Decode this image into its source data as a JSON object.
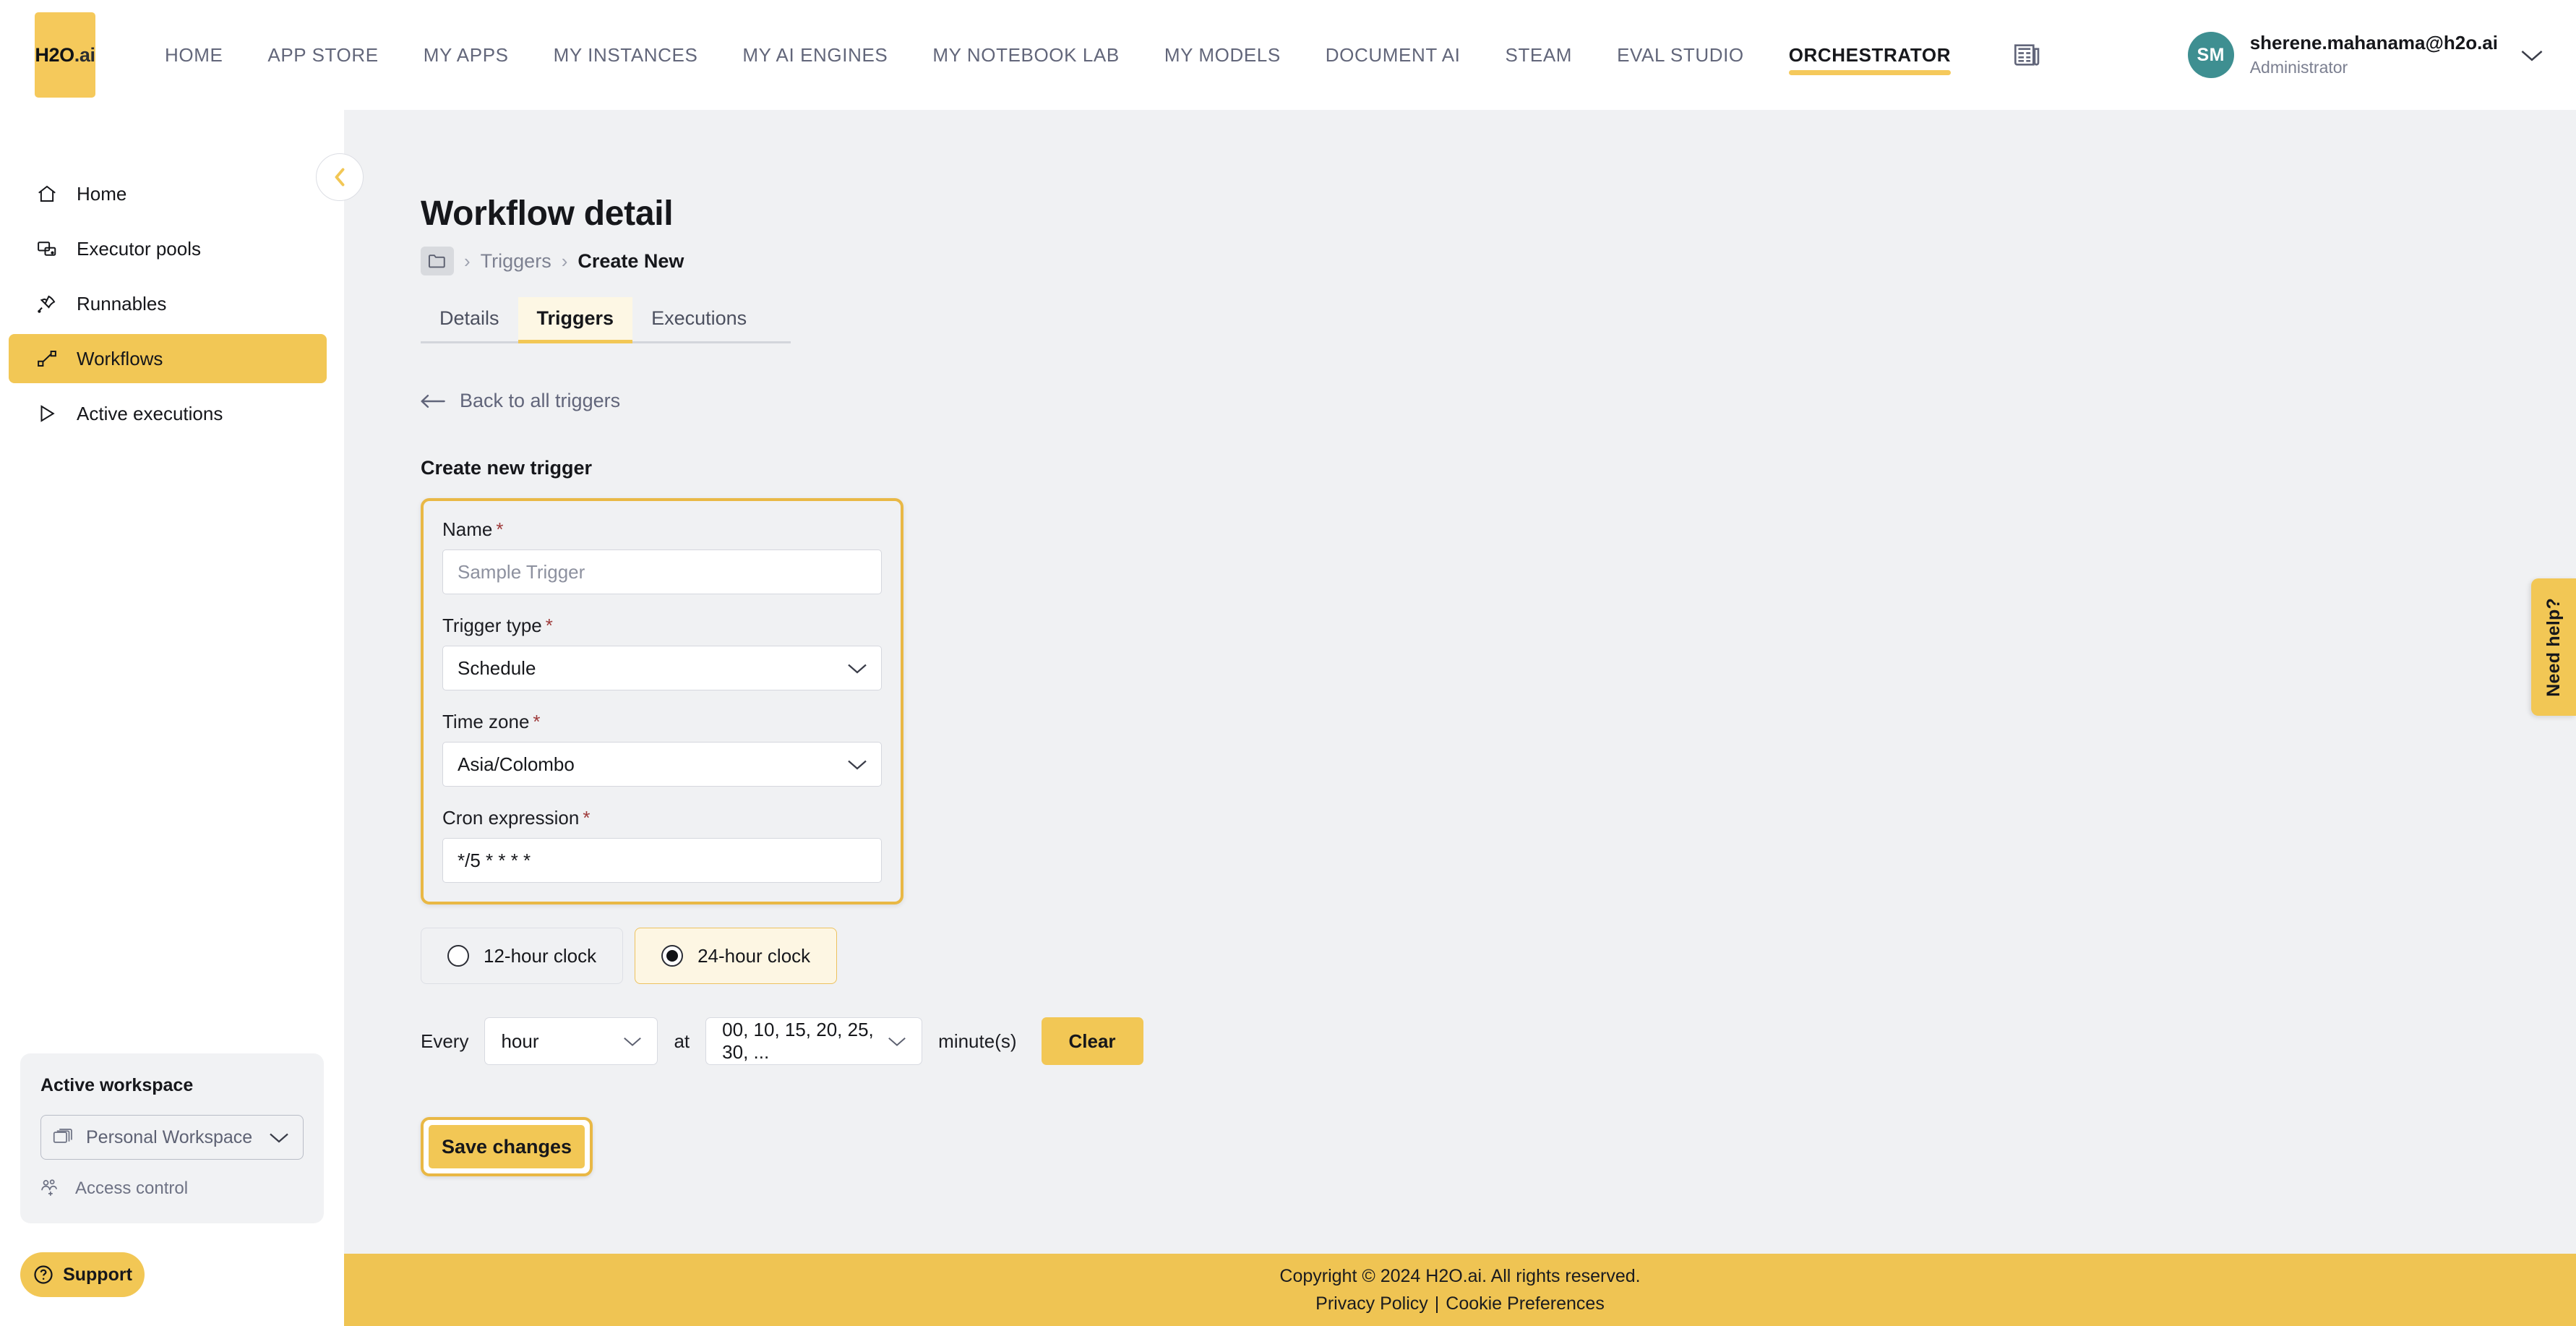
{
  "topnav": {
    "logo_text": "H2O",
    "logo_suffix": ".ai",
    "links": [
      {
        "label": "HOME",
        "active": false
      },
      {
        "label": "APP STORE",
        "active": false
      },
      {
        "label": "MY APPS",
        "active": false
      },
      {
        "label": "MY INSTANCES",
        "active": false
      },
      {
        "label": "MY AI ENGINES",
        "active": false
      },
      {
        "label": "MY NOTEBOOK LAB",
        "active": false
      },
      {
        "label": "MY MODELS",
        "active": false
      },
      {
        "label": "DOCUMENT AI",
        "active": false
      },
      {
        "label": "STEAM",
        "active": false
      },
      {
        "label": "EVAL STUDIO",
        "active": false
      },
      {
        "label": "ORCHESTRATOR",
        "active": true
      }
    ],
    "news_icon": "newspaper-icon",
    "user": {
      "initials": "SM",
      "email": "sherene.mahanama@h2o.ai",
      "role": "Administrator",
      "caret_icon": "chevron-down-icon"
    }
  },
  "sidebar": {
    "collapse_icon": "chevron-left-icon",
    "items": [
      {
        "label": "Home",
        "icon": "home-icon",
        "active": false
      },
      {
        "label": "Executor pools",
        "icon": "executor-pools-icon",
        "active": false
      },
      {
        "label": "Runnables",
        "icon": "rocket-icon",
        "active": false
      },
      {
        "label": "Workflows",
        "icon": "workflow-icon",
        "active": true
      },
      {
        "label": "Active executions",
        "icon": "play-triangle-icon",
        "active": false
      }
    ],
    "workspace": {
      "title": "Active workspace",
      "selected": "Personal Workspace",
      "select_icon": "stacked-windows-icon",
      "caret_icon": "chevron-down-icon",
      "access_control_label": "Access control",
      "access_control_icon": "users-add-icon"
    },
    "support": {
      "label": "Support",
      "icon": "question-circle-icon"
    }
  },
  "main": {
    "page_title": "Workflow detail",
    "breadcrumb": {
      "root_icon": "folder-icon",
      "separator": "›",
      "items": [
        {
          "label": "Triggers",
          "current": false
        },
        {
          "label": "Create New",
          "current": true
        }
      ]
    },
    "tabs": [
      {
        "label": "Details",
        "active": false
      },
      {
        "label": "Triggers",
        "active": true
      },
      {
        "label": "Executions",
        "active": false
      }
    ],
    "back_link": {
      "label": "Back to all triggers",
      "icon": "arrow-left-icon"
    },
    "section_title": "Create new trigger",
    "form": {
      "name": {
        "label": "Name",
        "required_marker": "*",
        "value": "",
        "placeholder": "Sample Trigger"
      },
      "trigger_type": {
        "label": "Trigger type",
        "required_marker": "*",
        "value": "Schedule",
        "caret_icon": "chevron-down-icon"
      },
      "time_zone": {
        "label": "Time zone",
        "required_marker": "*",
        "value": "Asia/Colombo",
        "caret_icon": "chevron-down-icon"
      },
      "cron_expression": {
        "label": "Cron expression",
        "required_marker": "*",
        "value": "*/5 * * * *",
        "placeholder": "*/5 * * * *"
      }
    },
    "clock_options": [
      {
        "label": "12-hour clock",
        "selected": false
      },
      {
        "label": "24-hour clock",
        "selected": true
      }
    ],
    "schedule_builder": {
      "every_label": "Every",
      "unit_value": "hour",
      "at_label": "at",
      "minutes_value": "00, 10, 15, 20, 25, 30, ...",
      "minutes_suffix": "minute(s)",
      "clear_label": "Clear",
      "caret_icon": "chevron-down-icon"
    },
    "save_button": {
      "label": "Save changes"
    }
  },
  "need_help": {
    "label": "Need help?"
  },
  "footer": {
    "copyright": "Copyright © 2024 H2O.ai. All rights reserved.",
    "privacy_label": "Privacy Policy",
    "separator": "|",
    "cookie_label": "Cookie Preferences"
  },
  "colors": {
    "brand_yellow": "#F2C755",
    "logo_yellow": "#F5C95B",
    "accent_border": "#E9B845",
    "footer_yellow": "#EFC453",
    "avatar_teal": "#3E8F91",
    "main_bg": "#F0F1F3",
    "required_red": "#9E3B3B",
    "tab_active_bg": "#FDF7E4"
  }
}
